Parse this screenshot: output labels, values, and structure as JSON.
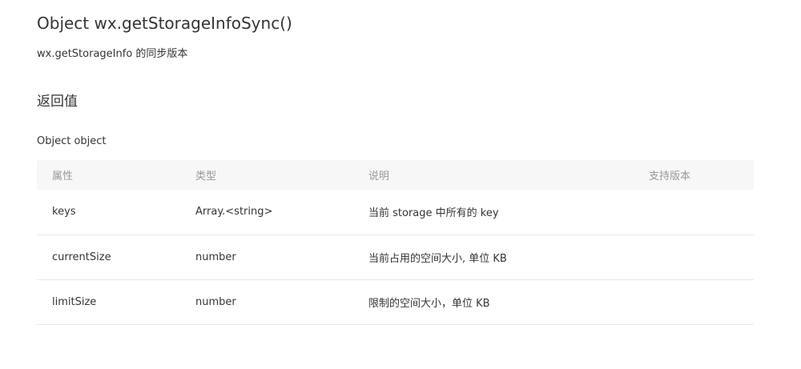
{
  "api": {
    "title": "Object wx.getStorageInfoSync()",
    "description": "wx.getStorageInfo 的同步版本"
  },
  "return_section": {
    "title": "返回值",
    "object_type": "Object object"
  },
  "table": {
    "headers": [
      "属性",
      "类型",
      "说明",
      "支持版本"
    ],
    "rows": [
      {
        "name": "keys",
        "type": "Array.<string>",
        "description": "当前 storage 中所有的 key",
        "version": ""
      },
      {
        "name": "currentSize",
        "type": "number",
        "description": "当前占用的空间大小, 单位 KB",
        "version": ""
      },
      {
        "name": "limitSize",
        "type": "number",
        "description": "限制的空间大小，单位 KB",
        "version": ""
      }
    ]
  }
}
